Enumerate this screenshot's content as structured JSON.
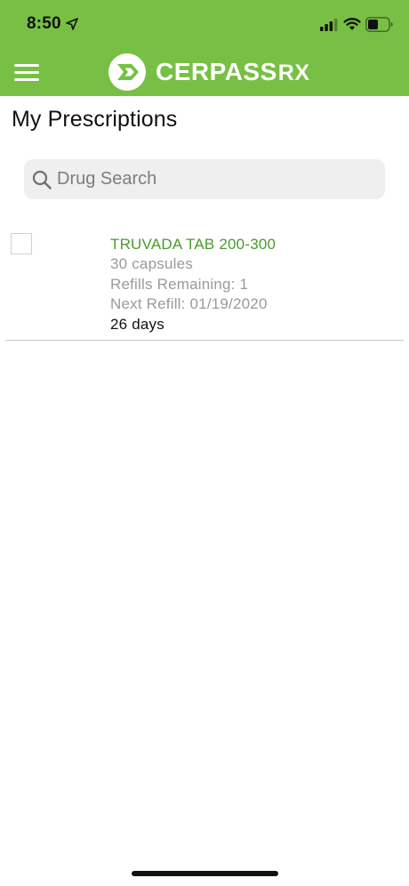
{
  "status_bar": {
    "time": "8:50",
    "icons": [
      "location-arrow-icon",
      "cellular-signal-icon",
      "wifi-icon",
      "battery-icon"
    ]
  },
  "header": {
    "menu_icon": "hamburger-menu-icon",
    "logo_text": "CERPASS",
    "logo_suffix": "RX",
    "background_color": "#77c043"
  },
  "page": {
    "title": "My Prescriptions"
  },
  "search": {
    "placeholder": "Drug Search",
    "value": "",
    "icon": "search-icon"
  },
  "prescriptions": [
    {
      "name": "TRUVADA TAB 200-300",
      "quantity": "30 capsules",
      "refills": "Refills Remaining: 1",
      "next_refill": "Next Refill: 01/19/2020",
      "days": "26 days",
      "checked": false
    }
  ],
  "colors": {
    "brand_green": "#77c043",
    "drug_name_green": "#4a9a2c",
    "secondary_text": "#9a9a9a"
  }
}
